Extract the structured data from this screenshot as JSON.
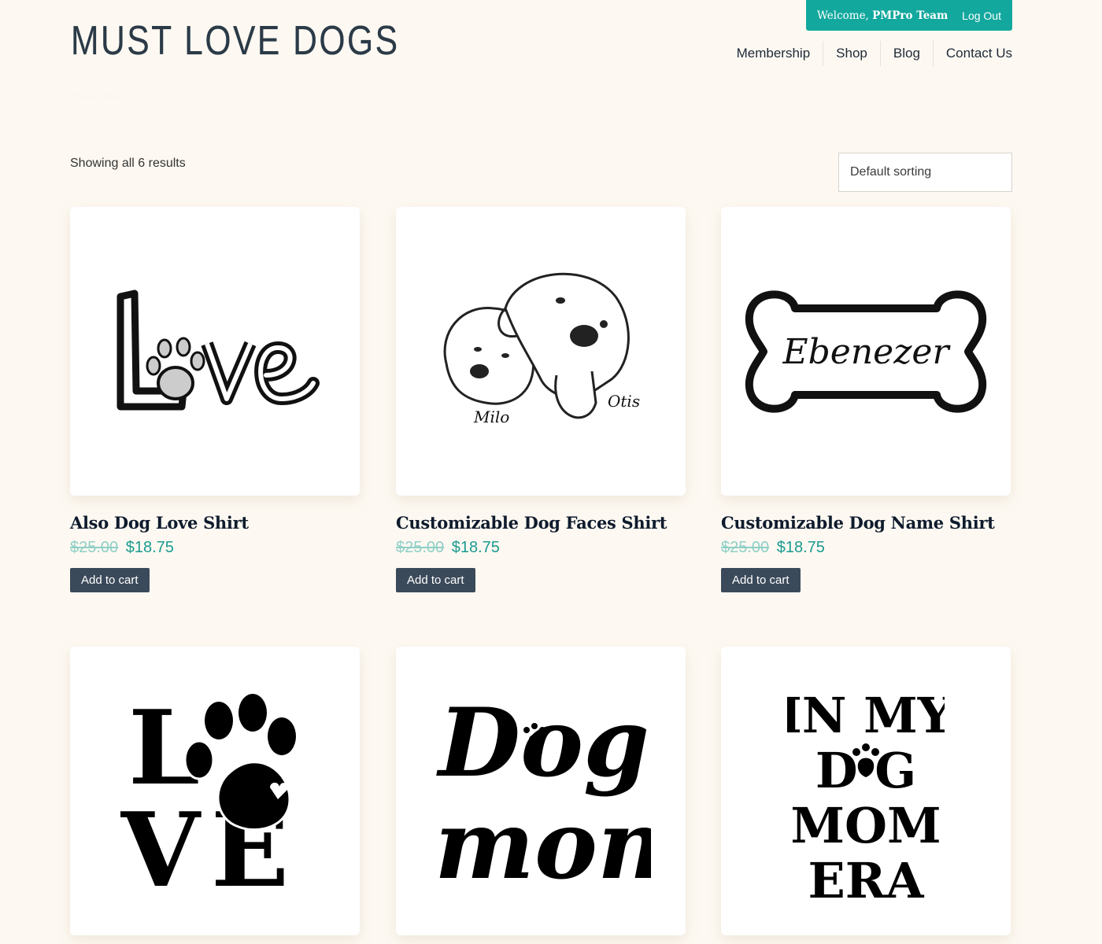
{
  "header": {
    "logo_text": "MUST LOVE DOGS",
    "welcome_prefix": "Welcome,",
    "welcome_user": "PMPro Team",
    "logout_label": "Log Out",
    "accent_color": "#13a89e"
  },
  "nav": {
    "items": [
      {
        "label": "Membership"
      },
      {
        "label": "Shop"
      },
      {
        "label": "Blog"
      },
      {
        "label": "Contact Us"
      }
    ]
  },
  "breadcrumb": "Home / Shop",
  "shop": {
    "result_count": "Showing all 6 results",
    "sorting_selected": "Default sorting"
  },
  "products": [
    {
      "title": "Also Dog Love Shirt",
      "regular_price": "$25.00",
      "sale_price": "$18.75",
      "button_label": "Add to cart",
      "image": "love-paw-outline-design"
    },
    {
      "title": "Customizable Dog Faces Shirt",
      "regular_price": "$25.00",
      "sale_price": "$18.75",
      "button_label": "Add to cart",
      "image": "two-dog-faces-sketch",
      "image_text": [
        "Milo",
        "Otis"
      ]
    },
    {
      "title": "Customizable Dog Name Shirt",
      "regular_price": "$25.00",
      "sale_price": "$18.75",
      "button_label": "Add to cart",
      "image": "dog-bone-name",
      "image_text": [
        "Ebenezer"
      ]
    },
    {
      "title": "",
      "image": "love-paw-heart-design",
      "image_text": [
        "L",
        "V",
        "E"
      ]
    },
    {
      "title": "",
      "image": "dog-mom-script",
      "image_text": [
        "Dog",
        "mom"
      ]
    },
    {
      "title": "",
      "image": "in-my-dog-mom-era",
      "image_text": [
        "IN MY",
        "D G",
        "MOM",
        "ERA"
      ]
    }
  ]
}
